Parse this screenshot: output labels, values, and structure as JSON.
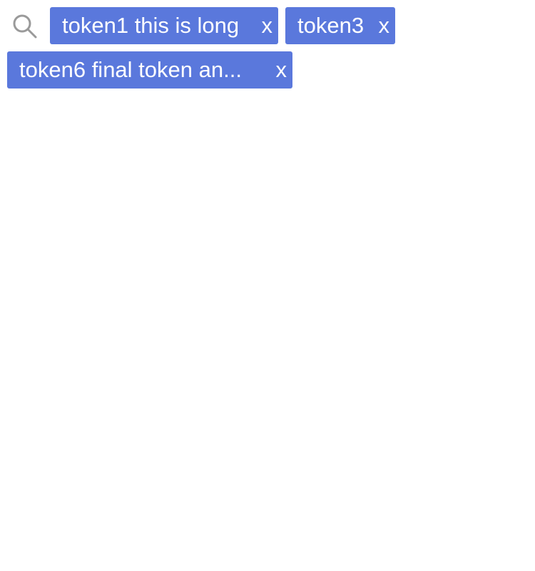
{
  "search": {
    "icon": "search-icon",
    "icon_color": "#9a9a9a"
  },
  "tokens": [
    {
      "label": "token1 this is long",
      "remove_label": "x"
    },
    {
      "label": "token3",
      "remove_label": "x"
    },
    {
      "label": "token6 final token an...",
      "remove_label": "x"
    }
  ],
  "colors": {
    "token_background": "#5a78dc",
    "token_text": "#ffffff",
    "page_background": "#ffffff"
  }
}
